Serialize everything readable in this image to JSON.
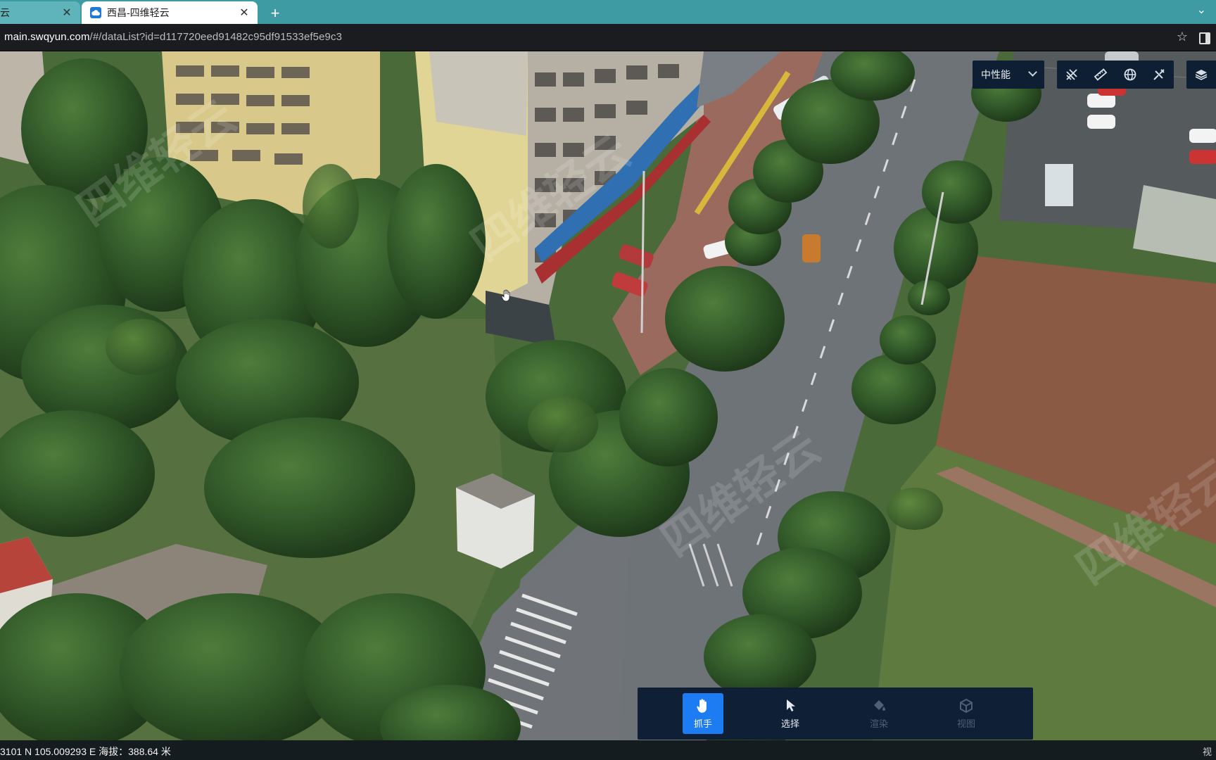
{
  "browser": {
    "tabs": [
      {
        "title": "云",
        "close_glyph": "✕"
      },
      {
        "title": "西昌-四维轻云",
        "close_glyph": "✕",
        "favicon": "cloud-icon"
      }
    ],
    "new_tab_glyph": "+",
    "tab_menu_glyph": "⌄",
    "url_host": "main.swqyun.com",
    "url_path": "/#/dataList?id=d117720eed91482c95df91533ef5e9c3",
    "star_glyph": "☆"
  },
  "map": {
    "watermarks": [
      "四维轻云",
      "四维轻云",
      "四维轻云",
      "四维轻云"
    ],
    "accent": "#1e7cf2",
    "panel_bg": "#0f2036"
  },
  "top_controls": {
    "performance_label": "中性能",
    "tools": [
      "measure-area-icon",
      "measure-distance-icon",
      "globe-icon",
      "measure-tool-icon"
    ],
    "layers": "layers-icon"
  },
  "bottom_toolbar": {
    "items": [
      {
        "label": "抓手",
        "icon": "hand-icon",
        "state": "active"
      },
      {
        "label": "选择",
        "icon": "pointer-icon",
        "state": "normal"
      },
      {
        "label": "渲染",
        "icon": "paint-bucket-icon",
        "state": "disabled"
      },
      {
        "label": "视图",
        "icon": "cube-icon",
        "state": "disabled"
      }
    ]
  },
  "status": {
    "coords": "3101 N 105.009293 E 海拔：388.64 米",
    "right": "视"
  }
}
